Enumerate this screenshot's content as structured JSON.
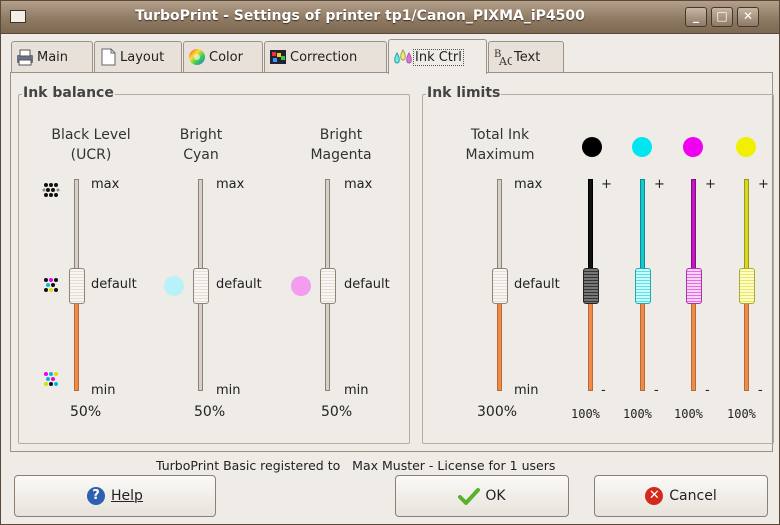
{
  "window": {
    "title": "TurboPrint - Settings of printer tp1/Canon_PIXMA_iP4500"
  },
  "tabs": [
    {
      "label": "Main",
      "icon": "printer-icon"
    },
    {
      "label": "Layout",
      "icon": "page-icon"
    },
    {
      "label": "Color",
      "icon": "color-wheel-icon"
    },
    {
      "label": "Correction",
      "icon": "correction-icon"
    },
    {
      "label": "Ink Ctrl",
      "icon": "ink-drops-icon",
      "active": true
    },
    {
      "label": "Text",
      "icon": "text-icon"
    }
  ],
  "ink_balance": {
    "title": "Ink balance",
    "sliders": [
      {
        "header": "Black Level\n(UCR)",
        "max": "max",
        "default": "default",
        "min": "min",
        "value": "50%"
      },
      {
        "header": "Bright\nCyan",
        "max": "max",
        "default": "default",
        "min": "min",
        "value": "50%",
        "color": "#b8f2f8"
      },
      {
        "header": "Bright\nMagenta",
        "max": "max",
        "default": "default",
        "min": "min",
        "value": "50%",
        "color": "#f49cf0"
      }
    ]
  },
  "ink_limits": {
    "title": "Ink limits",
    "total": {
      "header": "Total Ink\nMaximum",
      "max": "max",
      "default": "default",
      "min": "min",
      "value": "300%"
    },
    "channels": [
      {
        "color": "#000000",
        "plus": "+",
        "minus": "-",
        "value": "100%"
      },
      {
        "color": "#00e6f0",
        "plus": "+",
        "minus": "-",
        "value": "100%"
      },
      {
        "color": "#f000f0",
        "plus": "+",
        "minus": "-",
        "value": "100%"
      },
      {
        "color": "#f0f000",
        "plus": "+",
        "minus": "-",
        "value": "100%"
      }
    ]
  },
  "footer": {
    "registration": "TurboPrint Basic registered to   Max Muster - License for 1 users",
    "help": "Help",
    "ok": "OK",
    "cancel": "Cancel"
  }
}
